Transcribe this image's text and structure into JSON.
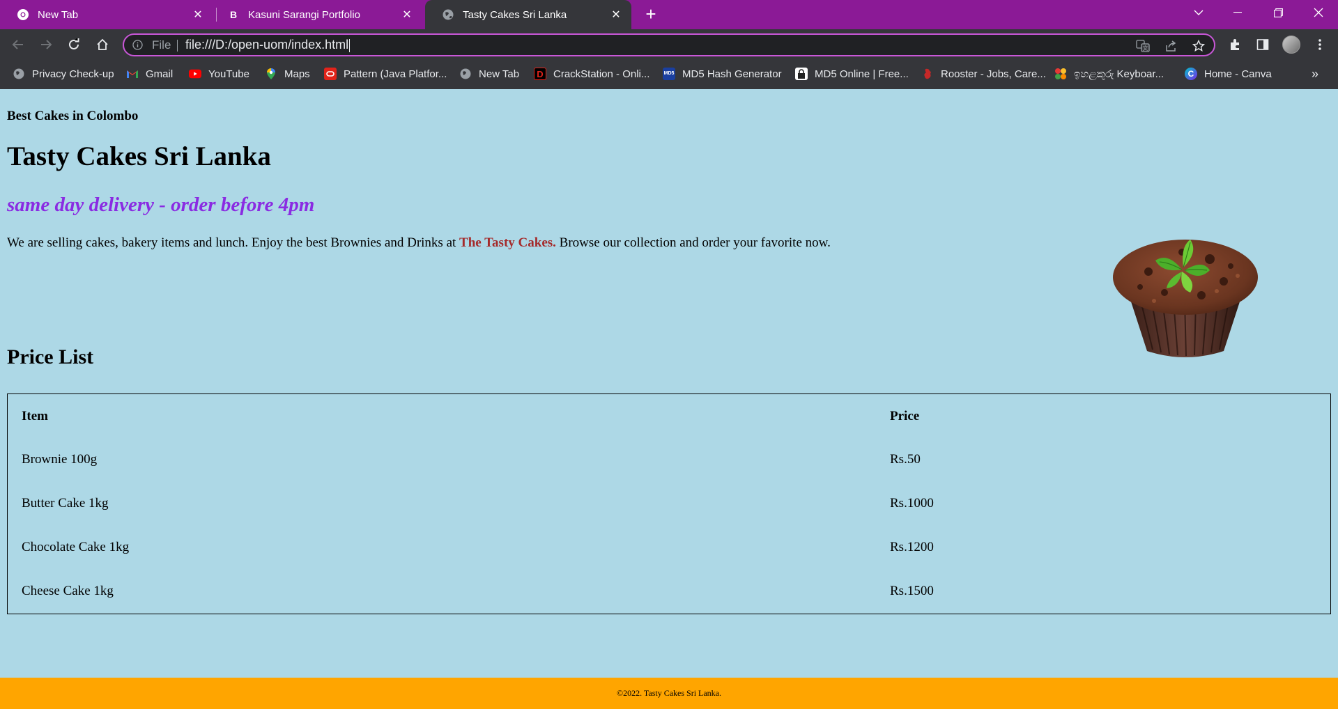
{
  "browser": {
    "tabs": [
      {
        "title": "New Tab",
        "icon": "chrome-icon",
        "active": false
      },
      {
        "title": "Kasuni Sarangi Portfolio",
        "icon": "bootstrap-icon",
        "active": false
      },
      {
        "title": "Tasty Cakes Sri Lanka",
        "icon": "globe-icon",
        "active": true
      }
    ],
    "address_bar": {
      "scheme_label": "File",
      "url": "file:///D:/open-uom/index.html"
    },
    "bookmarks": [
      {
        "label": "Privacy Check-up",
        "icon": "globe-icon"
      },
      {
        "label": "Gmail",
        "icon": "gmail-icon"
      },
      {
        "label": "YouTube",
        "icon": "youtube-icon"
      },
      {
        "label": "Maps",
        "icon": "maps-icon"
      },
      {
        "label": "Pattern (Java Platfor...",
        "icon": "oracle-icon"
      },
      {
        "label": "New Tab",
        "icon": "globe-icon"
      },
      {
        "label": "CrackStation - Onli...",
        "icon": "crackstation-icon"
      },
      {
        "label": "MD5 Hash Generator",
        "icon": "md5-icon"
      },
      {
        "label": "MD5 Online | Free...",
        "icon": "lock-icon"
      },
      {
        "label": "Rooster - Jobs, Care...",
        "icon": "rooster-icon"
      },
      {
        "label": "ඉහළකුරු Keyboar...",
        "icon": "keyboard-app-icon"
      },
      {
        "label": "Home - Canva",
        "icon": "canva-icon"
      }
    ],
    "colors": {
      "tab_strip": "#8B1A96",
      "toolbar": "#35363A",
      "omnibox_focus": "#C957D8"
    }
  },
  "page": {
    "tagline": "Best Cakes in Colombo",
    "title": "Tasty Cakes Sri Lanka",
    "delivery_note": "same day delivery - order before 4pm",
    "intro_before": "We are selling cakes, bakery items and lunch. Enjoy the best Brownies and Drinks at ",
    "intro_brand": "The Tasty Cakes.",
    "intro_after": " Browse our collection and order your favorite now.",
    "image": "chocolate-cupcake-image",
    "price_list": {
      "heading": "Price List",
      "columns": [
        "Item",
        "Price"
      ],
      "rows": [
        [
          "Brownie 100g",
          "Rs.50"
        ],
        [
          "Butter Cake 1kg",
          "Rs.1000"
        ],
        [
          "Chocolate Cake 1kg",
          "Rs.1200"
        ],
        [
          "Cheese Cake 1kg",
          "Rs.1500"
        ]
      ]
    },
    "footer": "©2022. Tasty Cakes Sri Lanka.",
    "colors": {
      "background": "#ADD8E6",
      "delivery": "#8A2BE2",
      "brand": "#A52A2A",
      "footer": "#FFA500"
    }
  }
}
